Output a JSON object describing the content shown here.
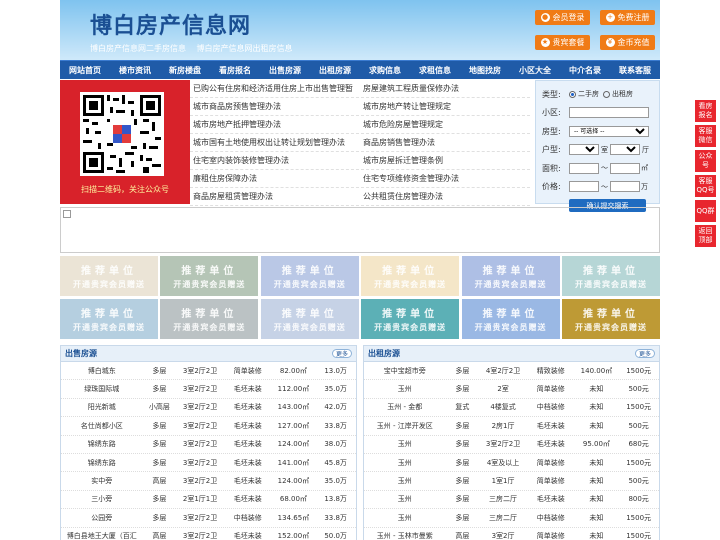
{
  "header": {
    "logo": "博白房产信息网",
    "sub": [
      "博白房产信息网二手房信息",
      "博白房产信息网出租房信息"
    ],
    "buttons": [
      {
        "label": "会员登录",
        "icon": "user-icon"
      },
      {
        "label": "免费注册",
        "icon": "user-add-icon"
      },
      {
        "label": "贵宾套餐",
        "icon": "vip-icon"
      },
      {
        "label": "金币充值",
        "icon": "coin-icon"
      }
    ]
  },
  "nav": [
    "网站首页",
    "楼市资讯",
    "新房楼盘",
    "看房报名",
    "出售房源",
    "出租房源",
    "求购信息",
    "求租信息",
    "地图找房",
    "小区大全",
    "中介名录",
    "联系客服"
  ],
  "qr": {
    "caption": "扫描二维码，关注公众号"
  },
  "links": [
    [
      "已购公有住房和经济适用住房上市出售管理暂",
      "房屋建筑工程质量保修办法"
    ],
    [
      "城市商品房预售管理办法",
      "城市房地产转让管理规定"
    ],
    [
      "城市房地产抵押管理办法",
      "城市危险房屋管理规定"
    ],
    [
      "城市国有土地使用权出让转让规划管理办法",
      "商品房销售管理办法"
    ],
    [
      "住宅室内装饰装修管理办法",
      "城市房屋拆迁管理条例"
    ],
    [
      "廉租住房保障办法",
      "住宅专项维修资金管理办法"
    ],
    [
      "商品房屋租赁管理办法",
      "公共租赁住房管理办法"
    ]
  ],
  "search": {
    "type_label": "类型:",
    "type_options": [
      "二手房",
      "出租房"
    ],
    "community_label": "小区:",
    "house_type_label": "房型:",
    "house_type_value": "-- 可选择 --",
    "layout_label": "户型:",
    "room_unit": "室",
    "hall_unit": "厅",
    "area_label": "面积:",
    "area_unit": "㎡",
    "price_label": "价格:",
    "price_unit": "万",
    "submit": "确认提交搜索"
  },
  "recommend": {
    "line1": "推荐单位",
    "line2": "开通贵宾会员赠送",
    "colors": [
      "#ebe4d6",
      "#b5c5b6",
      "#bac8e6",
      "#f4e6c8",
      "#aebfe5",
      "#b6d6d6",
      "#b5cfe0",
      "#bbc2c4",
      "#c6d2e6",
      "#5cb0b6",
      "#9ab8e4",
      "#be9a35"
    ]
  },
  "sale": {
    "title": "出售房源",
    "more": "更多",
    "rows": [
      [
        "博白城东",
        "多层",
        "3室2厅2卫",
        "简单装修",
        "82.00㎡",
        "13.0万"
      ],
      [
        "绿珠国际城",
        "多层",
        "3室2厅2卫",
        "毛坯未装",
        "112.00㎡",
        "35.0万"
      ],
      [
        "阳光新城",
        "小高层",
        "3室2厅2卫",
        "毛坯未装",
        "143.00㎡",
        "42.0万"
      ],
      [
        "名仕尚都小区",
        "多层",
        "3室2厅2卫",
        "毛坯未装",
        "127.00㎡",
        "33.8万"
      ],
      [
        "锦绣东路",
        "多层",
        "3室2厅2卫",
        "毛坯未装",
        "124.00㎡",
        "38.0万"
      ],
      [
        "锦绣东路",
        "多层",
        "3室2厅2卫",
        "毛坯未装",
        "141.00㎡",
        "45.8万"
      ],
      [
        "实中旁",
        "高层",
        "3室2厅2卫",
        "毛坯未装",
        "124.00㎡",
        "35.0万"
      ],
      [
        "三小旁",
        "多层",
        "2室1厅1卫",
        "毛坯未装",
        "68.00㎡",
        "13.8万"
      ],
      [
        "公园旁",
        "多层",
        "3室2厅2卫",
        "中档装修",
        "134.65㎡",
        "33.8万"
      ],
      [
        "博白县地王大厦（百汇",
        "高层",
        "3室2厅2卫",
        "毛坯未装",
        "152.00㎡",
        "50.0万"
      ]
    ]
  },
  "rent": {
    "title": "出租房源",
    "more": "更多",
    "rows": [
      [
        "宝中宝超市旁",
        "多层",
        "4室2厅2卫",
        "精致装修",
        "140.00㎡",
        "1500元"
      ],
      [
        "玉州",
        "多层",
        "2室",
        "简单装修",
        "未知",
        "500元"
      ],
      [
        "玉州 - 金都",
        "复式",
        "4楼复式",
        "中档装修",
        "未知",
        "1500元"
      ],
      [
        "玉州 - 江岸开发区",
        "多层",
        "2房1厅",
        "毛坯未装",
        "未知",
        "500元"
      ],
      [
        "玉州",
        "多层",
        "3室2厅2卫",
        "毛坯未装",
        "95.00㎡",
        "680元"
      ],
      [
        "玉州",
        "多层",
        "4室及以上",
        "简单装修",
        "未知",
        "1500元"
      ],
      [
        "玉州",
        "多层",
        "1室1厅",
        "简单装修",
        "未知",
        "500元"
      ],
      [
        "玉州",
        "多层",
        "三房二厅",
        "毛坯未装",
        "未知",
        "800元"
      ],
      [
        "玉州",
        "多层",
        "三房二厅",
        "中档装修",
        "未知",
        "1500元"
      ],
      [
        "玉州 - 玉林市曼紫",
        "高层",
        "3室2厅",
        "简单装修",
        "未知",
        "1500元"
      ]
    ]
  },
  "side": [
    "看房报名",
    "客服微信",
    "公众号",
    "客服QQ号",
    "QQ群",
    "返回顶部"
  ]
}
